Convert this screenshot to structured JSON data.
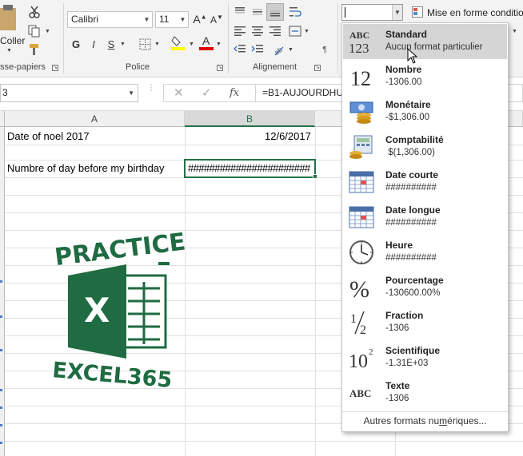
{
  "ribbon": {
    "clipboard": {
      "paste_label": "Coller",
      "group_label": "sse-papiers"
    },
    "font": {
      "name": "Calibri",
      "size": "11",
      "bold": "G",
      "italic": "I",
      "underline": "S",
      "group_label": "Police"
    },
    "alignment": {
      "group_label": "Alignement"
    },
    "number": {
      "format_value": "",
      "conditional_label": "Mise en forme conditio"
    }
  },
  "formula_bar": {
    "name_box": "3",
    "fx_label": "fx",
    "formula": "=B1-AUJOURDHU"
  },
  "grid": {
    "columns": [
      "A",
      "B"
    ],
    "cells": {
      "a1": "Date of noel 2017",
      "b1": "12/6/2017",
      "a3": "Numbre of day before my birthday",
      "b3": "#######################"
    }
  },
  "logo": {
    "top_text": "PRACTICE",
    "letter": "X",
    "bottom_text": "EXCEL365",
    "color": "#1f6b42"
  },
  "format_menu": {
    "items": [
      {
        "title": "Standard",
        "sub": "Aucun format particulier",
        "icon": "abc-123-icon"
      },
      {
        "title": "Nombre",
        "sub": "-1306.00",
        "icon": "number-12-icon"
      },
      {
        "title": "Monétaire",
        "sub": "-$1,306.00",
        "icon": "currency-icon"
      },
      {
        "title": "Comptabilité",
        "sub": " $(1,306.00)",
        "icon": "accounting-icon"
      },
      {
        "title": "Date courte",
        "sub": "##########",
        "icon": "calendar-short-icon"
      },
      {
        "title": "Date longue",
        "sub": "##########",
        "icon": "calendar-long-icon"
      },
      {
        "title": "Heure",
        "sub": "##########",
        "icon": "clock-icon"
      },
      {
        "title": "Pourcentage",
        "sub": "-130600.00%",
        "icon": "percent-icon"
      },
      {
        "title": "Fraction",
        "sub": "-1306",
        "icon": "fraction-icon"
      },
      {
        "title": "Scientifique",
        "sub": "-1.31E+03",
        "icon": "scientific-icon"
      },
      {
        "title": "Texte",
        "sub": "-1306",
        "icon": "abc-text-icon"
      }
    ],
    "footer_before": "Autres formats nu",
    "footer_underlined": "m",
    "footer_after": "ériques..."
  },
  "colors": {
    "excel_green": "#217346",
    "hover_gray": "#d5d5d5"
  }
}
